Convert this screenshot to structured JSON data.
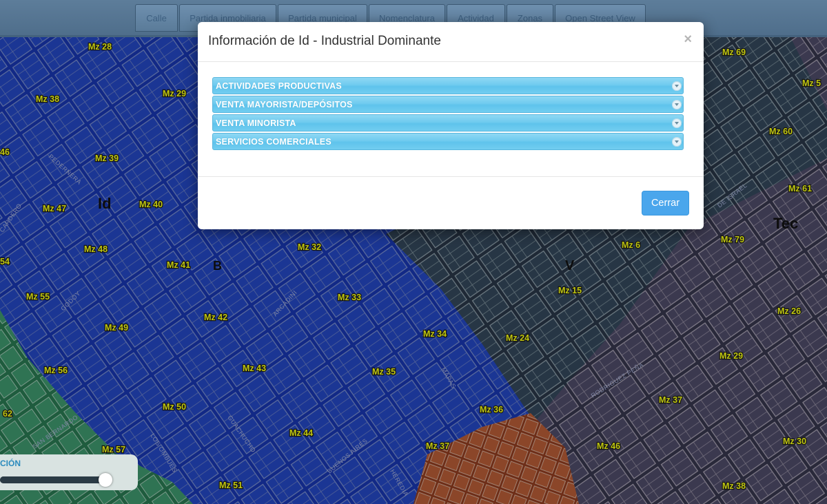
{
  "toolbar": {
    "buttons": [
      "Calle",
      "Partida inmobiliaria",
      "Partida municipal",
      "Nomenclatura",
      "Actividad",
      "Zonas",
      "Open Street View"
    ]
  },
  "modal": {
    "title": "Información de Id - Industrial Dominante",
    "close_symbol": "×",
    "sections": [
      "ACTIVIDADES PRODUCTIVAS",
      "VENTA MAYORISTA/DEPÓSITOS",
      "VENTA MINORISTA",
      "SERVICIOS COMERCIALES"
    ],
    "close_button": "Cerrar"
  },
  "slider": {
    "label": "CIÓN",
    "value": 0.97
  },
  "map": {
    "colors": {
      "industrial": "#1a3fb8",
      "commercial": "#3e5a6b",
      "residential": "#4d4b62",
      "green": "#3d9b69",
      "orange": "#c1582c"
    },
    "zones": [
      "Id",
      "B",
      "V",
      "Tec"
    ],
    "streets": [
      "PEDERNERA",
      "ARCADINI",
      "GODOY",
      "SAN BERNARDO",
      "LOS OMBUES",
      "GUACHUCHO",
      "BUENOS AIRES",
      "HEREDIA",
      "RODRIGUEZ PEÑA",
      "DE ISRAEL",
      "MAPAS",
      "CARDERO"
    ],
    "blocks": [
      "Mz 28",
      "Mz 29",
      "Mz 38",
      "Mz 39",
      "Mz 40",
      "Mz 47",
      "Mz 48",
      "Mz 41",
      "Mz 32",
      "Mz 33",
      "Mz 42",
      "Mz 49",
      "Mz 55",
      "Mz 56",
      "Mz 43",
      "Mz 34",
      "Mz 35",
      "Mz 50",
      "Mz 44",
      "Mz 36",
      "Mz 37",
      "Mz 57",
      "Mz 51",
      "Mz 6",
      "Mz 15",
      "Mz 24",
      "Mz 69",
      "Mz 60",
      "Mz 61",
      "Mz 79",
      "Mz 26",
      "Mz 29",
      "Mz 37",
      "Mz 46",
      "Mz 30",
      "Mz 38",
      "Mz 5",
      "46",
      "54",
      "62"
    ]
  }
}
